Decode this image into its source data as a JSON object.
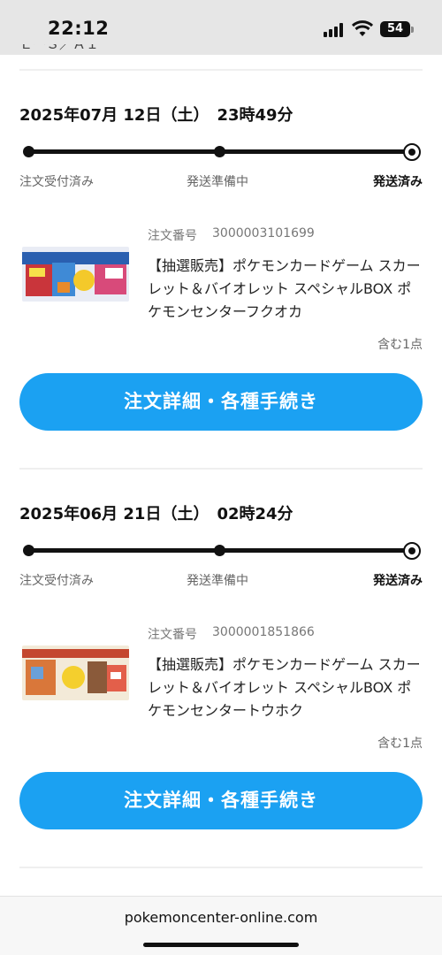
{
  "status_bar": {
    "time": "22:12",
    "battery": "54"
  },
  "top_cutoff_text": "ＥーＳ／ＡＩ",
  "orders": [
    {
      "date": "2025年07月 12日（土）　23時49分",
      "steps": [
        "注文受付済み",
        "発送準備中",
        "発送済み"
      ],
      "current_step": "発送済み",
      "order_number_label": "注文番号",
      "order_number": "3000003101699",
      "product_title": "【抽選販売】ポケモンカードゲーム スカーレット＆バイオレット スペシャルBOX ポケモンセンターフクオカ",
      "quantity": "含む1点",
      "button_label": "注文詳細・各種手続き"
    },
    {
      "date": "2025年06月 21日（土）　02時24分",
      "steps": [
        "注文受付済み",
        "発送準備中",
        "発送済み"
      ],
      "current_step": "発送済み",
      "order_number_label": "注文番号",
      "order_number": "3000001851866",
      "product_title": "【抽選販売】ポケモンカードゲーム スカーレット＆バイオレット スペシャルBOX ポケモンセンタートウホク",
      "quantity": "含む1点",
      "button_label": "注文詳細・各種手続き"
    }
  ],
  "url_bar": {
    "url": "pokemoncenter-online.com"
  },
  "colors": {
    "accent": "#1ba1f2",
    "status_bar_bg": "#e6e6e6"
  }
}
